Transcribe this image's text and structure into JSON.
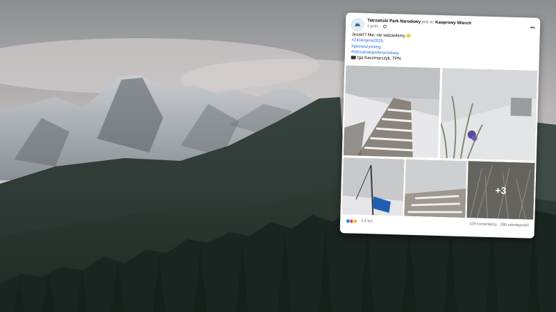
{
  "post": {
    "page_name": "Tatrzański Park Narodowy",
    "connector": "jest w:",
    "location": "Kasprowy Wierch",
    "time": "1 godz.",
    "dots": "•••",
    "text_line": "Jesień? Nie, nie widzieliśmy",
    "hashtags": [
      "#24sierpnia2025",
      "#pierwszysnieg",
      "#tatrzanskiparknarodowy"
    ],
    "credit": "Iga Kaczmarczyk, TPN",
    "more_photos": "+3",
    "reactions_count": "2,4 tys.",
    "comments": "109 komentarzy",
    "shares": "286 udostępnień"
  },
  "colors": {
    "link_blue": "#216fdb",
    "like_blue": "#1877f2",
    "love_red": "#f33e58",
    "haha_yellow": "#f7b928"
  },
  "icons": [
    "avatar-logo-icon",
    "globe-icon",
    "more-options-icon",
    "smile-emoji-icon",
    "camera-icon",
    "like-reaction-icon",
    "love-reaction-icon",
    "wow-reaction-icon"
  ]
}
